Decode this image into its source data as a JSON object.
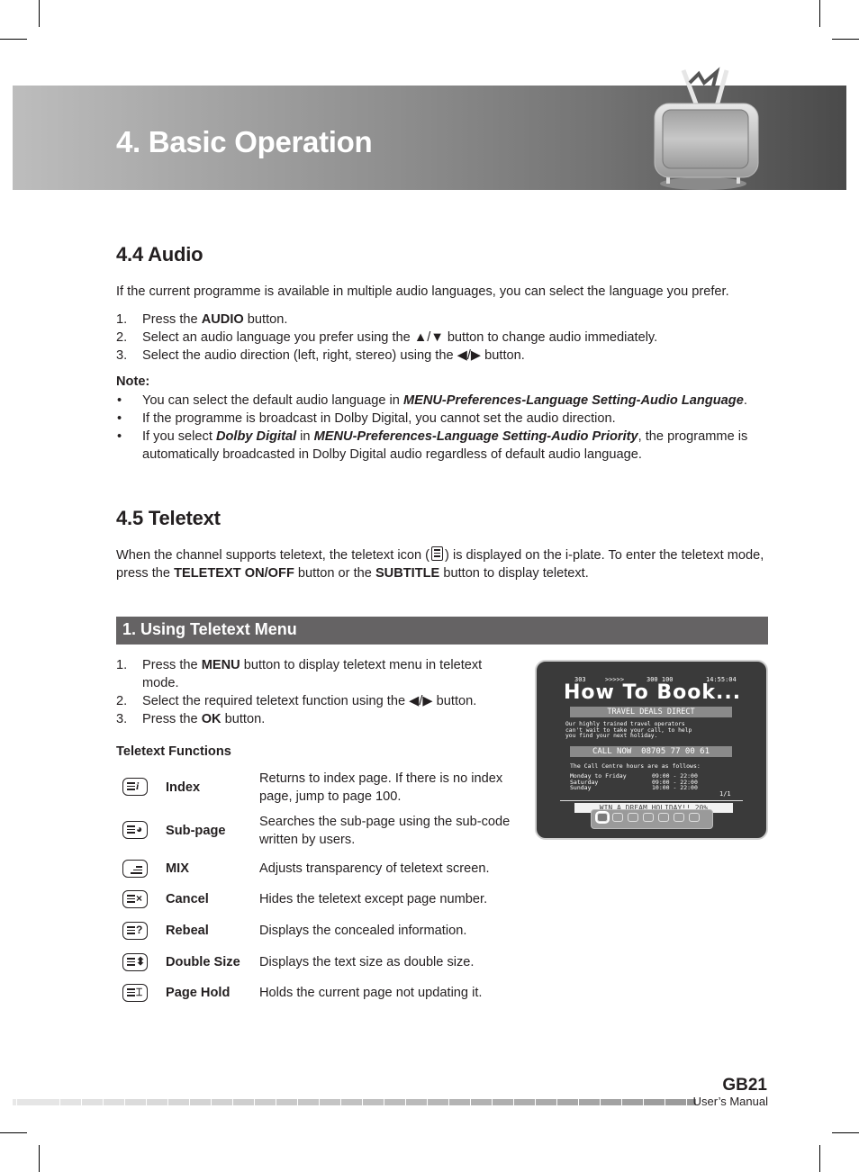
{
  "header": {
    "chapter_title": "4. Basic Operation",
    "illustration": "retro-tv-icon"
  },
  "audio_section": {
    "heading": "4.4 Audio",
    "intro": "If the current programme is available in multiple audio languages, you can select the language you prefer.",
    "steps": [
      {
        "num": "1.",
        "pre": "Press the ",
        "bold": "AUDIO",
        "post": " button."
      },
      {
        "num": "2.",
        "pre": "Select an audio language you prefer using the ▲/▼ button to change audio immediately.",
        "bold": "",
        "post": ""
      },
      {
        "num": "3.",
        "pre": "Select the audio direction (left, right, stereo) using the ◀/▶ button.",
        "bold": "",
        "post": ""
      }
    ],
    "note_label": "Note:",
    "notes": [
      {
        "pre": "You can select the default audio language in ",
        "bi1": "MENU-Preferences-Language Setting-Audio Language",
        "mid": "",
        "bi2": "",
        "post": "."
      },
      {
        "pre": "If the programme is broadcast in Dolby Digital, you cannot set the audio direction.",
        "bi1": "",
        "mid": "",
        "bi2": "",
        "post": ""
      },
      {
        "pre": "If you select ",
        "bi1": "Dolby Digital",
        "mid": " in ",
        "bi2": "MENU-Preferences-Language Setting-Audio Priority",
        "post": ", the programme is automatically broadcasted in Dolby Digital audio regardless of default audio language."
      }
    ]
  },
  "teletext_section": {
    "heading": "4.5 Teletext",
    "intro_pre": "When the channel supports teletext, the teletext icon (",
    "intro_icon": "teletext-icon",
    "intro_mid": ") is displayed on the i-plate. To enter the teletext mode, press the ",
    "intro_bold1": "TELETEXT ON/OFF",
    "intro_mid2": " button or the ",
    "intro_bold2": "SUBTITLE",
    "intro_post": " button to display teletext.",
    "subheading": "1. Using Teletext Menu",
    "steps": [
      {
        "num": "1.",
        "pre": "Press the ",
        "bold": "MENU",
        "post": " button to display teletext menu in teletext mode."
      },
      {
        "num": "2.",
        "pre": "Select the required teletext function using the ◀/▶ button.",
        "bold": "",
        "post": ""
      },
      {
        "num": "3.",
        "pre": "Press the ",
        "bold": "OK",
        "post": " button."
      }
    ],
    "functions_label": "Teletext Functions",
    "functions": [
      {
        "icon": "index-icon",
        "symbol": "i",
        "name": "Index",
        "desc": "Returns to index page. If there is no index page, jump to page 100."
      },
      {
        "icon": "sub-page-icon",
        "symbol": "◕",
        "name": "Sub-page",
        "desc": "Searches the sub-page using the sub-code written by users."
      },
      {
        "icon": "mix-icon",
        "symbol": "",
        "name": "MIX",
        "desc": "Adjusts transparency of teletext screen."
      },
      {
        "icon": "cancel-icon",
        "symbol": "×",
        "name": "Cancel",
        "desc": "Hides the teletext except page number."
      },
      {
        "icon": "reveal-icon",
        "symbol": "?",
        "name": "Rebeal",
        "desc": "Displays the concealed information."
      },
      {
        "icon": "double-size-icon",
        "symbol": "⬍",
        "name": "Double Size",
        "desc": "Displays the text size as double size."
      },
      {
        "icon": "page-hold-icon",
        "symbol": "⌶",
        "name": "Page Hold",
        "desc": "Holds the current page not updating it."
      }
    ]
  },
  "teletext_screen": {
    "status_line": {
      "page": "303",
      "arrows": ">>>>>",
      "pages": "300 100",
      "time": "14:55:04"
    },
    "title": "How To Book...",
    "banner1": "TRAVEL DEALS DIRECT",
    "body_lines": [
      "Our highly trained travel operators",
      "can't wait to take your call, to help",
      "you find your next holiday."
    ],
    "banner2": "CALL NOW  08705 77 00 61",
    "hours_intro": "The Call Centre hours are as follows:",
    "hours": [
      {
        "day": "Monday to Friday",
        "time": "09:00 - 22:00"
      },
      {
        "day": "Saturday",
        "time": "09:00 - 22:00"
      },
      {
        "day": "Sunday",
        "time": "10:00 - 22:00"
      }
    ],
    "subpage": "1/1",
    "bottom_banner": "WIN A DREAM HOLIDAY!! 20%",
    "menu_icons": [
      "index-icon",
      "sub-page-icon",
      "mix-icon",
      "cancel-icon",
      "reveal-icon",
      "double-size-icon",
      "page-hold-icon"
    ],
    "selected_menu_index": 0
  },
  "footer": {
    "page_number": "GB21",
    "manual_label": "User’s Manual"
  }
}
